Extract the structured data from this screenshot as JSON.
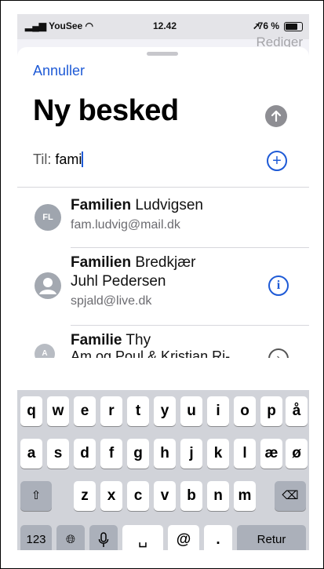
{
  "status_bar": {
    "carrier": "YouSee",
    "time": "12.42",
    "battery": "76 %",
    "background_action": "Rediger"
  },
  "compose": {
    "cancel_label": "Annuller",
    "title": "Ny besked",
    "to_label": "Til:",
    "to_value": "fami"
  },
  "contacts": [
    {
      "initials": "FL",
      "name_bold": "Familien",
      "name_rest": "Ludvigsen",
      "name_line2": "",
      "email": "fam.ludvig@mail.dk",
      "action": "none"
    },
    {
      "initials": "",
      "name_bold": "Familien",
      "name_rest": "Bredkjær",
      "name_line2": "Juhl Pedersen",
      "email": "spjald@live.dk",
      "action": "info-icon"
    },
    {
      "initials": "A",
      "name_bold": "Familie",
      "name_rest": "Thy",
      "name_line2": "Am og Poul & Kristian Ri-",
      "email": "",
      "action": "chevron-right-icon"
    }
  ],
  "keyboard": {
    "row1": [
      "q",
      "w",
      "e",
      "r",
      "t",
      "y",
      "u",
      "i",
      "o",
      "p",
      "å"
    ],
    "row2": [
      "a",
      "s",
      "d",
      "f",
      "g",
      "h",
      "j",
      "k",
      "l",
      "æ",
      "ø"
    ],
    "row3": [
      "z",
      "x",
      "c",
      "v",
      "b",
      "n",
      "m"
    ],
    "row4": {
      "numbers": "123",
      "at": "@",
      "dot": ".",
      "return": "Retur"
    }
  },
  "colors": {
    "accent": "#1e5ad6",
    "avatar": "#9fa5ae",
    "keyboard_bg": "#d1d3d9"
  }
}
